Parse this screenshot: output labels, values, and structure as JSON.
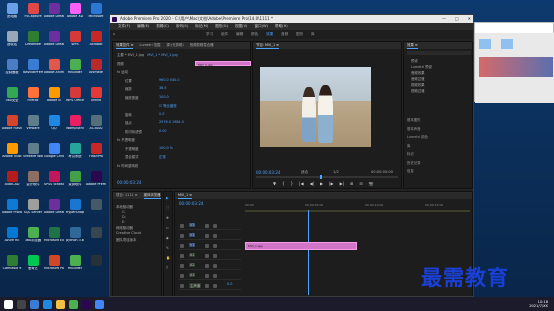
{
  "desktop_icons": [
    {
      "label": "此电脑",
      "color": "#6aa0e8"
    },
    {
      "label": "FSCapture",
      "color": "#e04848"
    },
    {
      "label": "Adobe Dream",
      "color": "#6b2f9e"
    },
    {
      "label": "Adobe XD",
      "color": "#ff61f6"
    },
    {
      "label": "Microsoft",
      "color": "#2b77d4"
    },
    {
      "label": "回收站",
      "color": "#9aa7b8"
    },
    {
      "label": "Dreamwe",
      "color": "#2e7d32"
    },
    {
      "label": "Adobe Dream",
      "color": "#6b2f9e"
    },
    {
      "label": "WPS",
      "color": "#d43a3a"
    },
    {
      "label": "Acrobat",
      "color": "#c62828"
    },
    {
      "label": "控制面板",
      "color": "#4a7dc4"
    },
    {
      "label": "NavicatPrem",
      "color": "#3a7bd5"
    },
    {
      "label": "Adobe Anim",
      "color": "#e2574c"
    },
    {
      "label": "HBuilder",
      "color": "#4caf50"
    },
    {
      "label": "Animate",
      "color": "#ba2a2a"
    },
    {
      "label": "360安全",
      "color": "#33a853"
    },
    {
      "label": "Firefox",
      "color": "#ff7139"
    },
    {
      "label": "Adobe Ill",
      "color": "#ff9a00"
    },
    {
      "label": "WPS Office",
      "color": "#d43a3a"
    },
    {
      "label": "XMind",
      "color": "#e53935"
    },
    {
      "label": "Adobe Flash",
      "color": "#d6452b"
    },
    {
      "label": "VMware",
      "color": "#607d8b"
    },
    {
      "label": "QQ",
      "color": "#1e88e5"
    },
    {
      "label": "WampServ",
      "color": "#e91e63"
    },
    {
      "label": "AC3000",
      "color": "#546e7a"
    },
    {
      "label": "Adobe Illust",
      "color": "#ff9a00"
    },
    {
      "label": "VMware Work",
      "color": "#607d8b"
    },
    {
      "label": "Google Chrome",
      "color": "#4285f4"
    },
    {
      "label": "考试系统",
      "color": "#26a69a"
    },
    {
      "label": "FlashPro",
      "color": "#c62828"
    },
    {
      "label": "AutoCAD",
      "color": "#b71c1c"
    },
    {
      "label": "会计软件",
      "color": "#8d6e63"
    },
    {
      "label": "SPSS Statistics",
      "color": "#c2185b"
    },
    {
      "label": "录屏软件",
      "color": "#43a047"
    },
    {
      "label": "Adobe Premie",
      "color": "#2a0850"
    },
    {
      "label": "Adobe Photos",
      "color": "#0b7bd6"
    },
    {
      "label": "SQL Server",
      "color": "#9e9e9e"
    },
    {
      "label": "Adobe Dream",
      "color": "#6b2f9e"
    },
    {
      "label": "HyperSnap",
      "color": "#1976d2"
    },
    {
      "label": "",
      "color": "#455a64"
    },
    {
      "label": "Azure RE",
      "color": "#0078d4"
    },
    {
      "label": "360浏览器",
      "color": "#4caf50"
    },
    {
      "label": "Microsoft Excel",
      "color": "#217346"
    },
    {
      "label": "python 3.6",
      "color": "#306998"
    },
    {
      "label": "",
      "color": "#37474f"
    },
    {
      "label": "Camtasia 9",
      "color": "#2e7d32"
    },
    {
      "label": "爱奇艺",
      "color": "#00c853"
    },
    {
      "label": "Microsoft PowerPoint",
      "color": "#d24726"
    },
    {
      "label": "HBuilder",
      "color": "#4caf50"
    },
    {
      "label": "",
      "color": "#263238"
    }
  ],
  "window": {
    "title": "Adobe Premiere Pro 2020 - C:\\用户\\Mac\\文档\\Adobe\\Premiere Pro\\14.0\\1111 *",
    "min": "—",
    "max": "□",
    "close": "✕"
  },
  "menu": [
    "文件(F)",
    "编辑(E)",
    "剪辑(C)",
    "序列(S)",
    "标记(M)",
    "图形(G)",
    "视图(V)",
    "窗口(W)",
    "帮助(H)"
  ],
  "workspaces": [
    "学习",
    "组件",
    "编辑",
    "颜色",
    "效果",
    "音频",
    "图形",
    "库"
  ],
  "active_workspace": "效果",
  "effect_controls": {
    "tabs": [
      "效果控件 ≡",
      "Lumetri 范围",
      "源:(无剪辑)",
      "音频剪辑混合器"
    ],
    "master": "主要 * MVI_1.jpg",
    "seq": "MVI_1 * MVI_1.jpg",
    "clip_label": "MVI_1.jpg",
    "section": "视频",
    "rows": [
      {
        "name": "fx 运动",
        "value": ""
      },
      {
        "name": "位置",
        "value": "960.0  540.0"
      },
      {
        "name": "缩放",
        "value": "36.5"
      },
      {
        "name": "缩放宽度",
        "value": "100.0"
      },
      {
        "name": "",
        "value": "☑ 等比缩放"
      },
      {
        "name": "旋转",
        "value": "0.0"
      },
      {
        "name": "锚点",
        "value": "2976.0  1984.0"
      },
      {
        "name": "防闪烁滤镜",
        "value": "0.00"
      },
      {
        "name": "fx 不透明度",
        "value": ""
      },
      {
        "name": "不透明度",
        "value": "100.0 %"
      },
      {
        "name": "混合模式",
        "value": "正常"
      },
      {
        "name": "fx 时间重映射",
        "value": ""
      }
    ],
    "timecode": "00:00:03:24"
  },
  "program": {
    "tab": "节目: MVI_1 ≡",
    "timecode_left": "00:00:03:24",
    "fit": "适合",
    "quality": "1/2",
    "timecode_right": "00:00:05:00",
    "controls": [
      "▼",
      "{",
      "}",
      "|◀",
      "◀|",
      "▶",
      "|▶",
      "▶|",
      "⊞",
      "⊟",
      "📷"
    ]
  },
  "right_panel": {
    "tabs": [
      "效果 ≡"
    ],
    "items": [
      "预设",
      "Lumetri 预设",
      "音频效果",
      "音频过渡",
      "视频效果",
      "视频过渡"
    ],
    "lower": [
      "基本图形",
      "基本声音",
      "Lumetri 颜色",
      "库",
      "标记",
      "历史记录",
      "信息"
    ]
  },
  "project": {
    "tabs": [
      "项目: 1111 ≡",
      "媒体浏览器"
    ],
    "items": [
      "本地驱动器",
      "网络驱动器",
      "Creative Cloud",
      "团队项目版本"
    ],
    "sub": [
      "C:",
      "D:",
      "E:"
    ]
  },
  "timeline": {
    "tab": "MVI_1 ≡",
    "timecode": "00:00:03:24",
    "ruler": [
      "00:00",
      "00:00:05:00",
      "00:00:10:00",
      "00:00:15:00"
    ],
    "tracks": [
      "V3",
      "V2",
      "V1",
      "A1",
      "A2",
      "A3",
      "主声道"
    ],
    "clip": "MVI_1.jpg",
    "master_level": "0.0"
  },
  "tools": [
    "▶",
    "⬚",
    "✥",
    "⇔",
    "◆",
    "✎",
    "✋",
    "T"
  ],
  "right_window": {
    "title": "",
    "labels": [
      "快速访问",
      "桌面",
      "下载",
      "文档",
      "图片"
    ]
  },
  "brand": "最需教育",
  "clock": {
    "time": "10:18",
    "date": "2021/7/XX"
  },
  "colors": {
    "accent": "#4aa3ff",
    "clip": "#d274c8",
    "brand": "#1a3fd4"
  }
}
